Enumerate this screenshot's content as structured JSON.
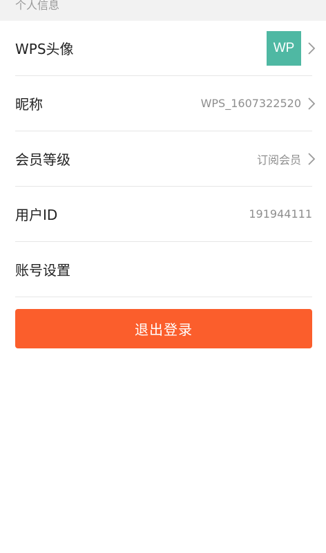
{
  "section": {
    "title": "个人信息"
  },
  "rows": {
    "avatar": {
      "label": "WPS头像",
      "avatar_text": "WP"
    },
    "nickname": {
      "label": "昵称",
      "value": "WPS_1607322520"
    },
    "membership": {
      "label": "会员等级",
      "value": "订阅会员"
    },
    "user_id": {
      "label": "用户ID",
      "value": "191944111"
    },
    "account": {
      "label": "账号设置"
    }
  },
  "actions": {
    "logout_label": "退出登录"
  },
  "colors": {
    "accent": "#fb5e2c",
    "avatar_bg": "#4fb8a3",
    "header_bg": "#f2f2f2"
  },
  "icons": {
    "chevron": "chevron-right-icon"
  }
}
